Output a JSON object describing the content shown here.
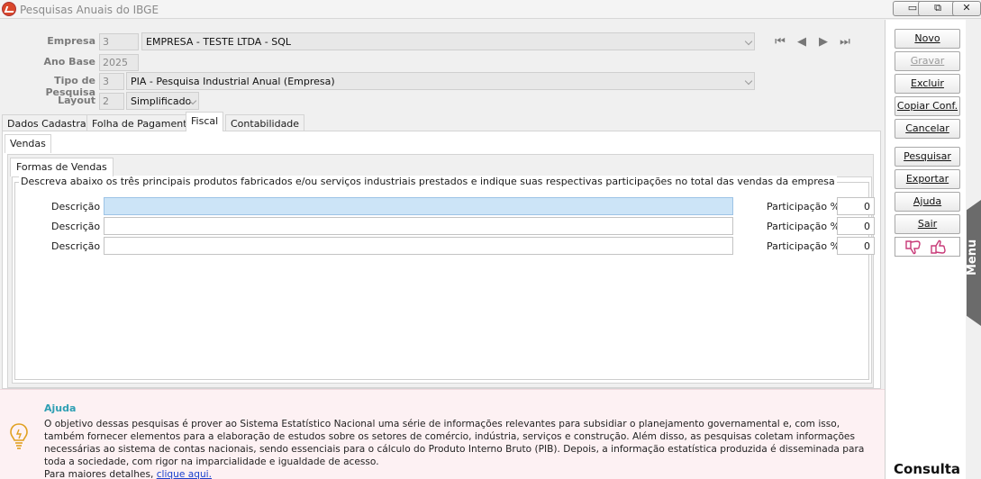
{
  "window": {
    "title": "Pesquisas Anuais do IBGE",
    "controls": [
      "minimize",
      "restore",
      "close"
    ]
  },
  "form": {
    "empresa": {
      "label": "Empresa",
      "code": "3",
      "value": "EMPRESA - TESTE LTDA - SQL"
    },
    "ano_base": {
      "label": "Ano Base",
      "value": "2025"
    },
    "tipo_pesquisa": {
      "label": "Tipo de Pesquisa",
      "code": "3",
      "value": "PIA - Pesquisa Industrial Anual (Empresa)"
    },
    "layout": {
      "label": "Layout",
      "code": "2",
      "value": "Simplificado"
    }
  },
  "record_nav": [
    "first",
    "previous",
    "next",
    "last"
  ],
  "tabs": [
    {
      "label": "Dados Cadastrais",
      "active": false
    },
    {
      "label": "Folha de Pagamento",
      "active": false
    },
    {
      "label": "Fiscal",
      "active": true
    },
    {
      "label": "Contabilidade",
      "active": false
    }
  ],
  "subtab": {
    "label": "Vendas"
  },
  "subsubtab": {
    "label": "Formas de Vendas"
  },
  "group": {
    "title": "Descreva abaixo os três principais produtos fabricados e/ou serviços industriais prestados e indique suas respectivas participações no total das vendas da empresa",
    "rows": [
      {
        "desc_label": "Descrição",
        "desc_value": "",
        "part_label": "Participação %",
        "part_value": "0"
      },
      {
        "desc_label": "Descrição",
        "desc_value": "",
        "part_label": "Participação %",
        "part_value": "0"
      },
      {
        "desc_label": "Descrição",
        "desc_value": "",
        "part_label": "Participação %",
        "part_value": "0"
      }
    ]
  },
  "help": {
    "title": "Ajuda",
    "text": "O objetivo dessas pesquisas é prover ao Sistema Estatístico Nacional uma série de informações relevantes para subsidiar o planejamento governamental e, com isso, também fornecer elementos para a elaboração de estudos sobre os setores de comércio, indústria, serviços e construção. Além disso, as pesquisas coletam informações necessárias ao sistema de contas nacionais, sendo essenciais para o cálculo do Produto Interno Bruto (PIB). Depois, a informação estatística produzida é disseminada para toda a sociedade, com rigor na imparcialidade e igualdade de acesso.",
    "more_prefix": "Para maiores detalhes,",
    "link_text": "clique aqui."
  },
  "actions": {
    "novo": "Novo",
    "gravar": "Gravar",
    "excluir": "Excluir",
    "copiar": "Copiar Conf.",
    "cancelar": "Cancelar",
    "pesquisar": "Pesquisar",
    "exportar": "Exportar",
    "ajuda": "Ajuda",
    "sair": "Sair"
  },
  "mode": "Consulta",
  "side_menu": "Menu",
  "colors": {
    "accent_help_title": "#2e9fb3",
    "help_bg": "#fdf1f3",
    "focus_field": "#cce4f7",
    "feedback_icons": "#c83a78",
    "link": "#1a3fcc"
  }
}
